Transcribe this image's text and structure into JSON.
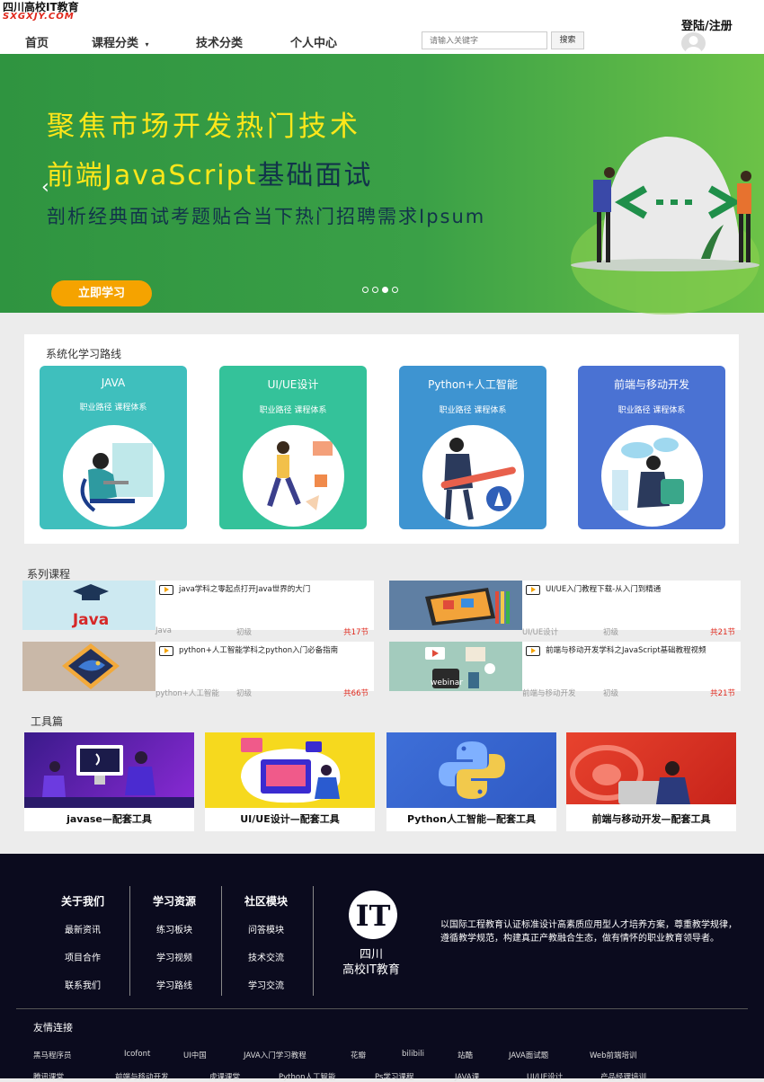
{
  "logo": {
    "title": "四川高校IT教育",
    "domain": "SXGXJY.COM"
  },
  "nav": [
    {
      "label": "首页"
    },
    {
      "label": "课程分类",
      "caret": "▾"
    },
    {
      "label": "技术分类"
    },
    {
      "label": "个人中心"
    }
  ],
  "search": {
    "placeholder": "请输入关键字",
    "button": "搜索"
  },
  "account": {
    "login_label": "登陆/注册"
  },
  "banner": {
    "line1": "聚焦市场开发热门技术",
    "line2_prefix": "前端JavaScript",
    "line2_suffix": "基础面试",
    "line3": "剖析经典面试考题贴合当下热门招聘需求Ipsum",
    "button": "立即学习",
    "slide_count": 4,
    "active_slide": 3
  },
  "route": {
    "title": "系统化学习路线",
    "cards": [
      {
        "title": "JAVA",
        "subtitle": "职业路径 课程体系",
        "color": "#3fbfbd"
      },
      {
        "title": "UI/UE设计",
        "subtitle": "职业路径 课程体系",
        "color": "#34c29a"
      },
      {
        "title": "Python+人工智能",
        "subtitle": "职业路径 课程体系",
        "color": "#3e94d1"
      },
      {
        "title": "前端与移动开发",
        "subtitle": "职业路径 课程体系",
        "color": "#4a72d3"
      }
    ]
  },
  "series": {
    "title": "系列课程",
    "courses": [
      {
        "title": "java学科之零起点打开Java世界的大门",
        "category": "Java",
        "level": "初级",
        "count": "共17节",
        "image_text": "Java"
      },
      {
        "title": "UI/UE入门教程下载-从入门到精通",
        "category": "UI/UE设计",
        "level": "初级",
        "count": "共21节"
      },
      {
        "title": "python+人工智能学科之python入门必备指南",
        "category": "python+人工智能",
        "level": "初级",
        "count": "共66节"
      },
      {
        "title": "前端与移动开发学科之JavaScript基础教程视频",
        "category": "前端与移动开发",
        "level": "初级",
        "count": "共21节",
        "image_text": "webinar"
      }
    ]
  },
  "tools": {
    "title": "工具篇",
    "items": [
      {
        "name": "javase—配套工具"
      },
      {
        "name": "UI/UE设计—配套工具"
      },
      {
        "name": "Python人工智能—配套工具"
      },
      {
        "name": "前端与移动开发—配套工具"
      }
    ]
  },
  "footer": {
    "columns": [
      {
        "heading": "关于我们",
        "items": [
          "最新资讯",
          "项目合作",
          "联系我们"
        ]
      },
      {
        "heading": "学习资源",
        "items": [
          "练习板块",
          "学习视频",
          "学习路线"
        ]
      },
      {
        "heading": "社区模块",
        "items": [
          "问答模块",
          "技术交流",
          "学习交流"
        ]
      }
    ],
    "logo_text": "IT",
    "brand_line1": "四川",
    "brand_line2": "高校IT教育",
    "description": "以国际工程教育认证标准设计高素质应用型人才培养方案，尊重教学规律，遵循教学规范，构建真正产教融合生态，做有情怀的职业教育领导者。",
    "links_title": "友情连接",
    "links_row1": [
      "黑马程序员",
      "Icofont",
      "UI中国",
      "JAVA入门学习教程",
      "花瓣",
      "bilibili",
      "站酷",
      "JAVA面试题",
      "Web前端培训"
    ],
    "links_row2": [
      "腾讯课堂",
      "前端与移动开发",
      "虎课课堂",
      "Python人工智能",
      "Ps学习课程",
      "JAVA课",
      "UI/UE设计",
      "产品经理培训"
    ]
  }
}
